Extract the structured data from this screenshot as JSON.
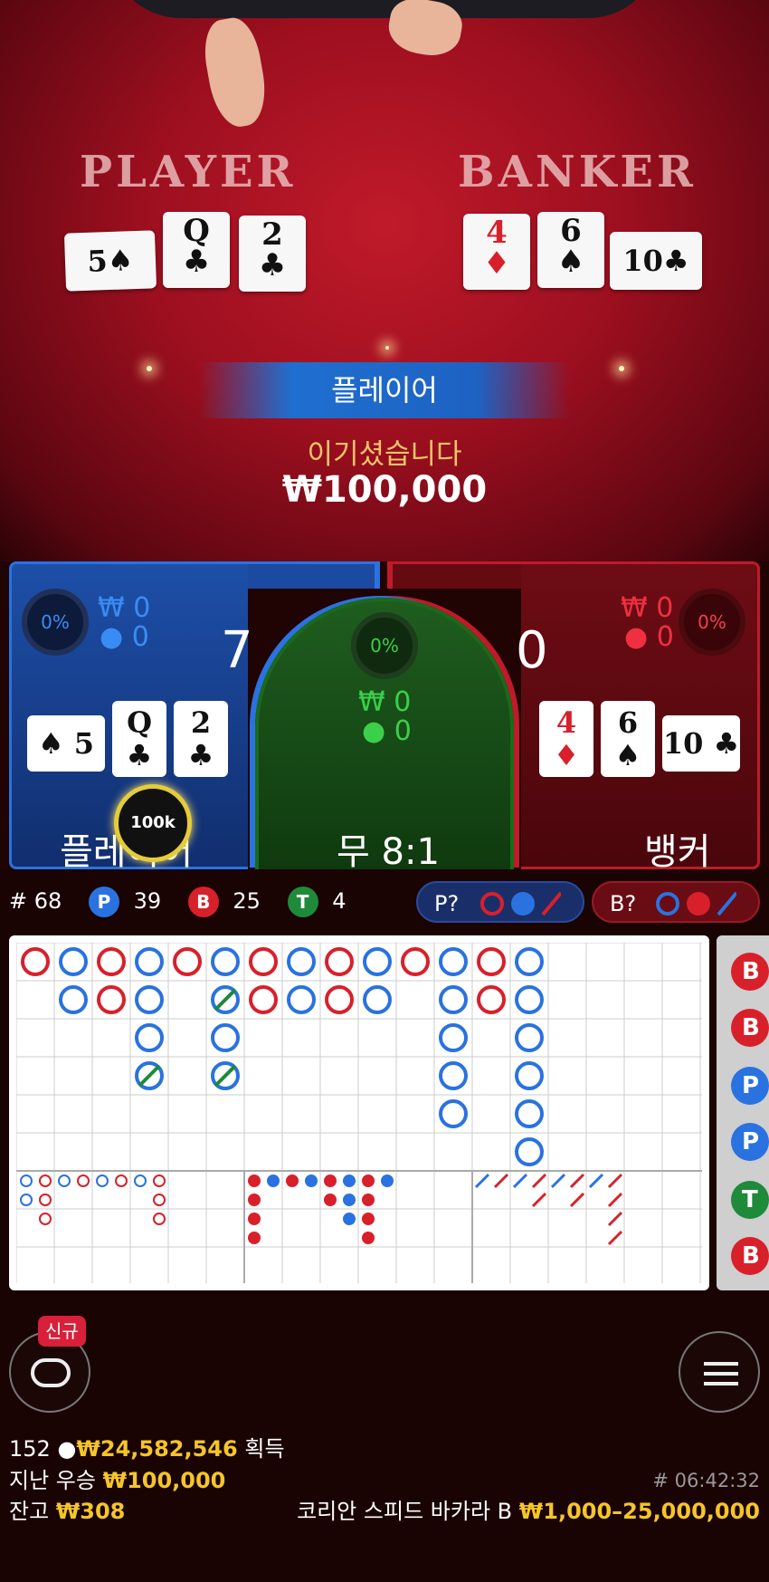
{
  "video": {
    "player_title": "PLAYER",
    "banker_title": "BANKER",
    "player_cards": [
      {
        "rank": "5",
        "suit": "♠",
        "color": "black",
        "orientation": "horizontal"
      },
      {
        "rank": "Q",
        "suit": "♣",
        "color": "black",
        "orientation": "vertical"
      },
      {
        "rank": "2",
        "suit": "♣",
        "color": "black",
        "orientation": "vertical"
      }
    ],
    "banker_cards": [
      {
        "rank": "4",
        "suit": "♦",
        "color": "red",
        "orientation": "vertical"
      },
      {
        "rank": "6",
        "suit": "♠",
        "color": "black",
        "orientation": "vertical"
      },
      {
        "rank": "10",
        "suit": "♣",
        "color": "black",
        "orientation": "horizontal"
      }
    ],
    "result_label": "플레이어",
    "win_label": "이기셨습니다",
    "win_amount": "₩100,000"
  },
  "bet": {
    "player": {
      "percent": "0%",
      "amount": "0",
      "players": "0",
      "score": "7",
      "label": "플레이어",
      "currency": "₩"
    },
    "tie": {
      "percent": "0%",
      "amount": "0",
      "players": "0",
      "label": "무 8:1",
      "currency": "₩"
    },
    "banker": {
      "percent": "0%",
      "amount": "0",
      "players": "0",
      "score": "0",
      "label": "뱅커",
      "currency": "₩"
    },
    "chip": "100k",
    "player_cards": [
      {
        "rank": "5",
        "suit": "♠",
        "color": "black"
      },
      {
        "rank": "Q",
        "suit": "♣",
        "color": "black"
      },
      {
        "rank": "2",
        "suit": "♣",
        "color": "black"
      }
    ],
    "banker_cards": [
      {
        "rank": "4",
        "suit": "♦",
        "color": "red"
      },
      {
        "rank": "6",
        "suit": "♠",
        "color": "black"
      },
      {
        "rank": "10",
        "suit": "♣",
        "color": "black"
      }
    ]
  },
  "stats": {
    "hash": "#",
    "rounds": "68",
    "p_label": "P",
    "p_count": "39",
    "b_label": "B",
    "b_count": "25",
    "t_label": "T",
    "t_count": "4",
    "p_predict": "P?",
    "b_predict": "B?"
  },
  "side_beads": [
    "B",
    "B",
    "P",
    "P",
    "T",
    "B"
  ],
  "colors": {
    "player": "#2a72e0",
    "banker": "#d8202b",
    "tie": "#1e8a3a",
    "gold": "#f5c52a"
  },
  "footer": {
    "badge": "신규",
    "players_online": "152",
    "total_won": "₩24,582,546",
    "won_suffix": "획득",
    "last_win_label": "지난 우승",
    "last_win_amount": "₩100,000",
    "balance_label": "잔고",
    "balance": "₩308",
    "round_id": "# 06:42:32",
    "table_name": "코리안 스피드 바카라 B",
    "limits": "₩1,000–25,000,000"
  },
  "icons": {
    "left_button": "table-icon",
    "right_button": "menu-icon"
  }
}
